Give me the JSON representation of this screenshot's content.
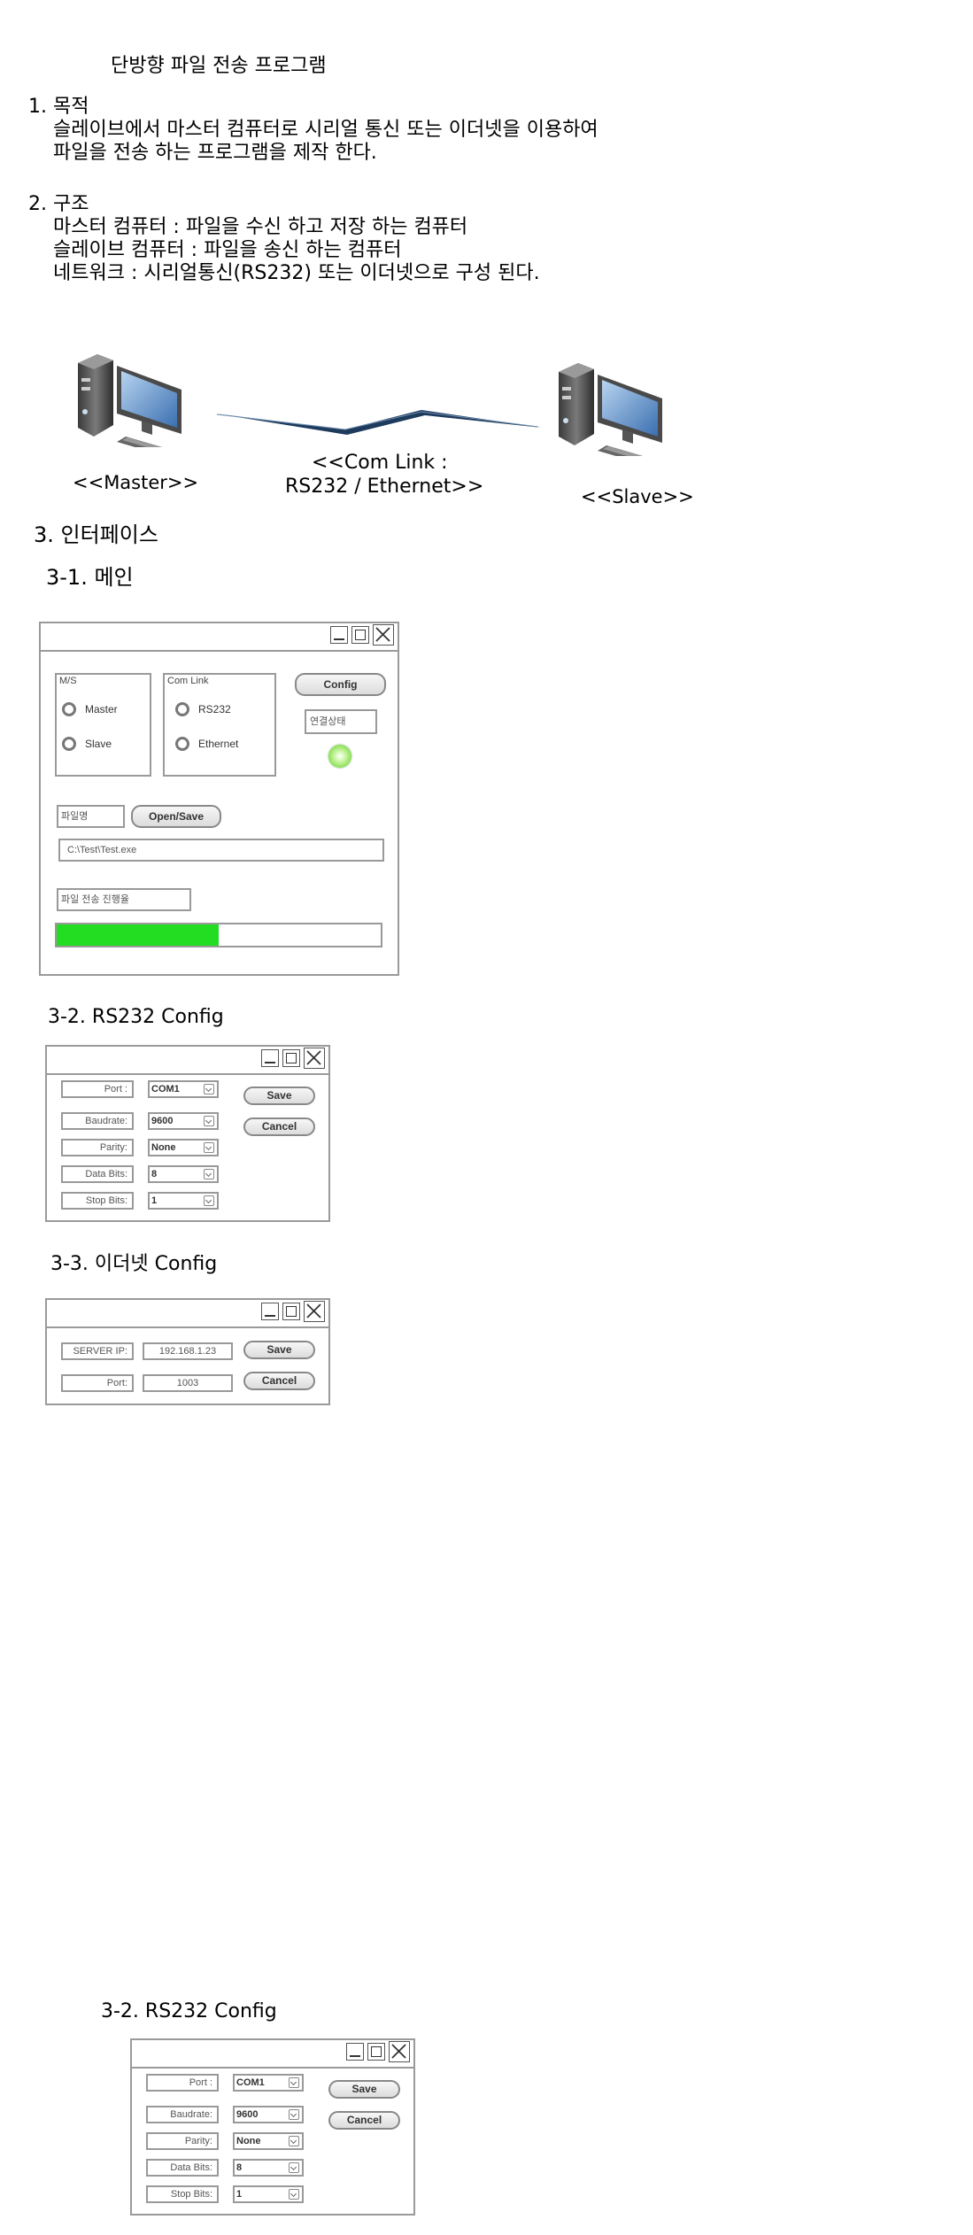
{
  "title": "단방향 파일 전송 프로그램",
  "sections": {
    "purpose": {
      "heading": "1. 목적",
      "line1": "슬레이브에서 마스터 컴퓨터로 시리얼 통신 또는 이더넷을 이용하여",
      "line2": "파일을 전송 하는 프로그램을 제작 한다."
    },
    "structure": {
      "heading": "2. 구조",
      "line1": "마스터 컴퓨터 : 파일을 수신 하고 저장 하는 컴퓨터",
      "line2": "슬레이브 컴퓨터 : 파일을 송신 하는 컴퓨터",
      "line3": "네트워크 : 시리얼통신(RS232) 또는 이더넷으로 구성 된다."
    },
    "diagram": {
      "master_label": "<<Master>>",
      "link_label_1": "<<Com Link :",
      "link_label_2": "RS232 / Ethernet>>",
      "slave_label": "<<Slave>>"
    },
    "interface": {
      "heading": "3. 인터페이스",
      "main_heading": "3-1. 메인",
      "rs232_heading": "3-2. RS232 Config",
      "ethernet_heading": "3-3. 이더넷 Config",
      "rs232_heading_repeat": "3-2. RS232 Config"
    }
  },
  "main_window": {
    "ms_group": "M/S",
    "master_option": "Master",
    "slave_option": "Slave",
    "comlink_group": "Com Link",
    "rs232_option": "RS232",
    "ethernet_option": "Ethernet",
    "config_button": "Config",
    "status_label": "연결상태",
    "status_color": "#8ee05a",
    "filename_label": "파일명",
    "open_save_button": "Open/Save",
    "file_path": "C:\\Test\\Test.exe",
    "progress_label": "파일 전송 진행율",
    "progress_fraction": 0.5,
    "progress_color": "#22dd22"
  },
  "rs232_window": {
    "fields": [
      {
        "label": "Port :",
        "value": "COM1"
      },
      {
        "label": "Baudrate:",
        "value": "9600"
      },
      {
        "label": "Parity:",
        "value": "None"
      },
      {
        "label": "Data Bits:",
        "value": "8"
      },
      {
        "label": "Stop Bits:",
        "value": "1"
      }
    ],
    "save_button": "Save",
    "cancel_button": "Cancel"
  },
  "ethernet_window": {
    "server_ip_label": "SERVER IP:",
    "server_ip_value": "192.168.1.23",
    "port_label": "Port:",
    "port_value": "1003",
    "save_button": "Save",
    "cancel_button": "Cancel"
  },
  "icons": {
    "computer": "desktop-computer-icon",
    "minimize": "minimize-icon",
    "maximize": "maximize-icon",
    "close": "close-icon",
    "dropdown": "chevron-down-icon"
  }
}
